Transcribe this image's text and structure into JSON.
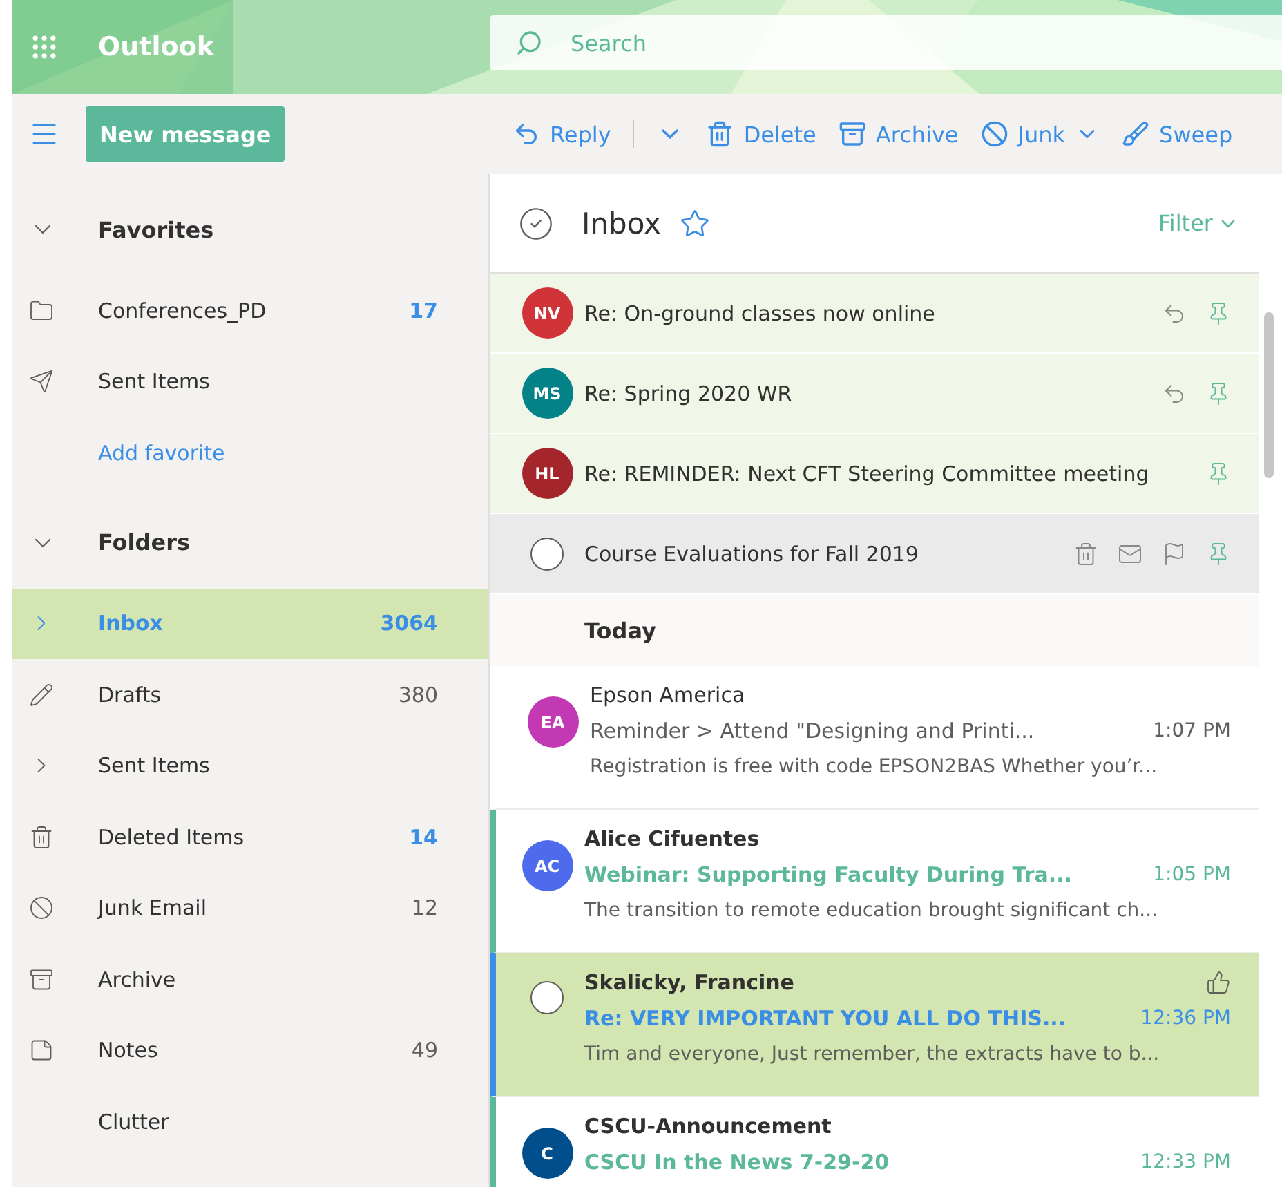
{
  "app": {
    "name": "Outlook"
  },
  "search": {
    "placeholder": "Search"
  },
  "new_message": "New message",
  "toolbar": [
    {
      "kind": "reply",
      "label": "Reply",
      "dropdown": true
    },
    {
      "kind": "delete",
      "label": "Delete",
      "dropdown": false
    },
    {
      "kind": "archive",
      "label": "Archive",
      "dropdown": false
    },
    {
      "kind": "junk",
      "label": "Junk",
      "dropdown": true
    },
    {
      "kind": "sweep",
      "label": "Sweep",
      "dropdown": false
    }
  ],
  "sidebar": {
    "sections": [
      {
        "title": "Favorites",
        "expanded": true,
        "items": [
          {
            "kind": "folder",
            "label": "Conferences_PD",
            "count": "17",
            "unread": true,
            "selected": false
          },
          {
            "kind": "send",
            "label": "Sent Items",
            "selected": false
          },
          {
            "kind": "link",
            "label": "Add favorite",
            "selected": false
          }
        ]
      },
      {
        "title": "Folders",
        "expanded": true,
        "items": [
          {
            "kind": "chevron",
            "label": "Inbox",
            "count": "3064",
            "unread": true,
            "selected": true
          },
          {
            "kind": "pencil",
            "label": "Drafts",
            "count": "380",
            "unread": false,
            "selected": false
          },
          {
            "kind": "chevron",
            "label": "Sent Items",
            "selected": false
          },
          {
            "kind": "trash",
            "label": "Deleted Items",
            "count": "14",
            "unread": true,
            "selected": false
          },
          {
            "kind": "block",
            "label": "Junk Email",
            "count": "12",
            "unread": false,
            "selected": false
          },
          {
            "kind": "archive",
            "label": "Archive",
            "selected": false
          },
          {
            "kind": "note",
            "label": "Notes",
            "count": "49",
            "unread": false,
            "selected": false
          },
          {
            "kind": "none",
            "label": "Clutter",
            "selected": false
          }
        ]
      }
    ]
  },
  "list": {
    "title": "Inbox",
    "filter": "Filter",
    "pinned": [
      {
        "initials": "NV",
        "color": "#d13438",
        "subject": "Re: On-ground classes now online",
        "hovered": false,
        "actions": [
          {
            "kind": "reply"
          },
          {
            "kind": "pin"
          }
        ]
      },
      {
        "initials": "MS",
        "color": "#038387",
        "subject": "Re: Spring 2020 WR",
        "hovered": false,
        "actions": [
          {
            "kind": "reply"
          },
          {
            "kind": "pin"
          }
        ]
      },
      {
        "initials": "HL",
        "color": "#a4262c",
        "subject": "Re: REMINDER: Next CFT Steering Committee meeting",
        "hovered": false,
        "actions": [
          {
            "kind": "pin"
          }
        ]
      },
      {
        "subject": "Course Evaluations for Fall 2019",
        "hovered": true,
        "actions": [
          {
            "kind": "delete"
          },
          {
            "kind": "read"
          },
          {
            "kind": "flag"
          },
          {
            "kind": "pin"
          }
        ]
      }
    ],
    "group": "Today",
    "emails": [
      {
        "initials": "EA",
        "color": "#c239b3",
        "sender": "Epson America",
        "subject": "Reminder > Attend \"Designing and Printi...",
        "time": "1:07 PM",
        "preview": "Registration is free with code EPSON2BAS Whether you’r...",
        "unread": false,
        "selected": false,
        "hovered": false
      },
      {
        "initials": "AC",
        "color": "#4f6bed",
        "sender": "Alice Cifuentes",
        "subject": "Webinar: Supporting Faculty During Tra...",
        "time": "1:05 PM",
        "preview": "The transition to remote education brought significant ch...",
        "unread": true,
        "selected": false,
        "hovered": false
      },
      {
        "sender": "Skalicky, Francine",
        "subject": "Re: VERY IMPORTANT YOU ALL DO THIS...",
        "time": "12:36 PM",
        "preview": "Tim and everyone, Just remember, the extracts have to b...",
        "unread": false,
        "selected": true,
        "hovered": true
      },
      {
        "initials": "C",
        "color": "#004e8c",
        "sender": "CSCU-Announcement",
        "subject": "CSCU In the News 7-29-20",
        "time": "12:33 PM",
        "unread": true,
        "selected": false,
        "hovered": false
      }
    ]
  }
}
